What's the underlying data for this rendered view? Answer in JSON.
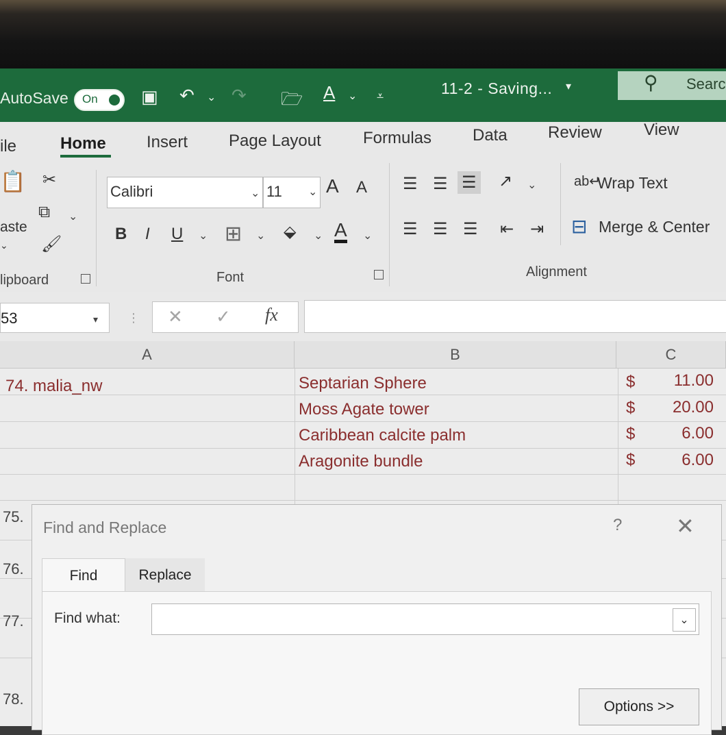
{
  "titlebar": {
    "autosave_label": "AutoSave",
    "autosave_state": "On",
    "doc_title": "11-2  -  Saving...",
    "search_placeholder": "Searc"
  },
  "ribbon": {
    "tabs": [
      "ile",
      "Home",
      "Insert",
      "Page Layout",
      "Formulas",
      "Data",
      "Review",
      "View"
    ],
    "active_tab": "Home",
    "clipboard": {
      "paste_label": "aste",
      "group_label": "lipboard"
    },
    "font": {
      "family": "Calibri",
      "size": "11",
      "group_label": "Font",
      "bold": "B",
      "italic": "I",
      "underline": "U",
      "grow": "A",
      "shrink": "A",
      "color_letter": "A"
    },
    "alignment": {
      "wrap_text": "Wrap Text",
      "merge_center": "Merge & Center",
      "group_label": "Alignment"
    }
  },
  "formula_bar": {
    "name_box": "53",
    "fx": "fx",
    "value": ""
  },
  "grid": {
    "columns": [
      "A",
      "B",
      "C"
    ],
    "rows": [
      {
        "a": "74. malia_nw",
        "b": "Septarian Sphere",
        "currency": "$",
        "c": "11.00"
      },
      {
        "a": "",
        "b": "Moss Agate tower",
        "currency": "$",
        "c": "20.00"
      },
      {
        "a": "",
        "b": "Caribbean calcite palm",
        "currency": "$",
        "c": "6.00"
      },
      {
        "a": "",
        "b": "Aragonite bundle",
        "currency": "$",
        "c": "6.00"
      }
    ],
    "side_labels": [
      "75.",
      "76.",
      "77.",
      "78."
    ]
  },
  "dialog": {
    "title": "Find and Replace",
    "help": "?",
    "tabs": [
      "Find",
      "Replace"
    ],
    "find_label": "Find what:",
    "find_value": "",
    "options_label": "Options >>"
  },
  "colors": {
    "excel_green": "#1d6b3c",
    "cell_text": "#8a2e2e"
  }
}
